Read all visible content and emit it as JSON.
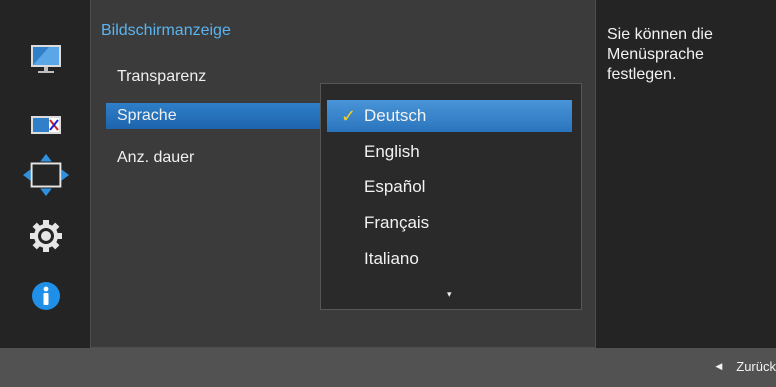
{
  "menu": {
    "title": "Bildschirmanzeige",
    "items": [
      {
        "label": "Transparenz"
      },
      {
        "label": "Sprache"
      },
      {
        "label": "Anz. dauer"
      }
    ]
  },
  "dropdown": {
    "selected": "Deutsch",
    "options": [
      "Deutsch",
      "English",
      "Español",
      "Français",
      "Italiano"
    ],
    "more_indicator": "▾"
  },
  "help": {
    "text": "Sie können die Menüsprache festlegen."
  },
  "footer": {
    "back_label": "Zurück"
  },
  "sidebar": {
    "icons": [
      "picture-icon",
      "color-icon",
      "position-icon",
      "settings-icon",
      "info-icon"
    ]
  },
  "colors": {
    "accent": "#2a74bd",
    "title": "#5ab4f0",
    "check": "#f5d020"
  }
}
